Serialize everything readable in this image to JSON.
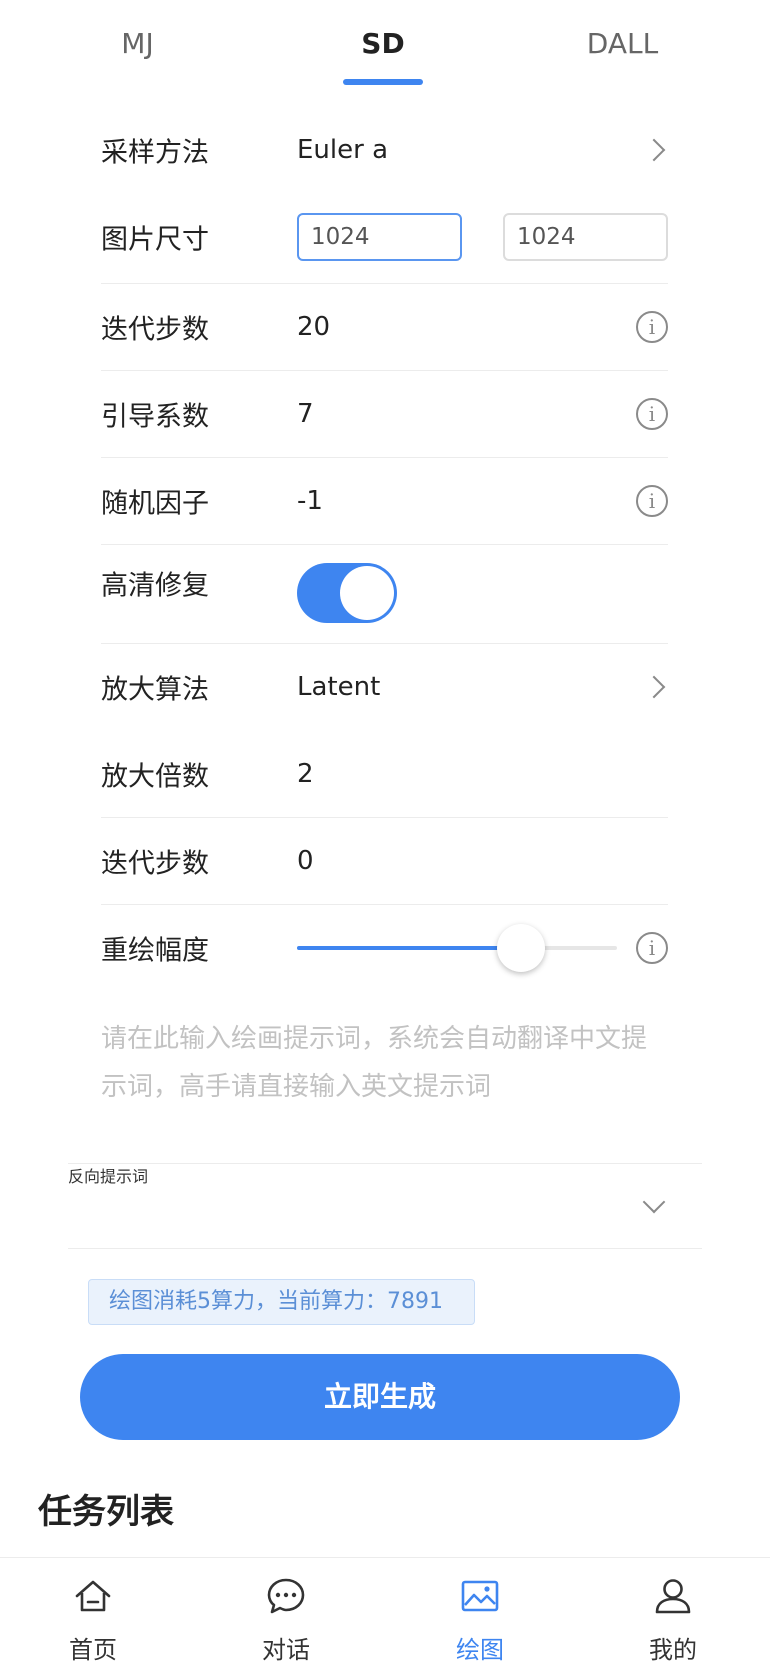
{
  "tabs": [
    {
      "label": "MJ",
      "active": false
    },
    {
      "label": "SD",
      "active": true
    },
    {
      "label": "DALL",
      "active": false
    }
  ],
  "form": {
    "sampler": {
      "label": "采样方法",
      "value": "Euler a"
    },
    "image_size": {
      "label": "图片尺寸",
      "width_value": "1024",
      "height_value": "1024"
    },
    "steps": {
      "label": "迭代步数",
      "value": "20"
    },
    "cfg_scale": {
      "label": "引导系数",
      "value": "7"
    },
    "seed": {
      "label": "随机因子",
      "value": "-1"
    },
    "hires_fix": {
      "label": "高清修复",
      "enabled": true
    },
    "upscaler": {
      "label": "放大算法",
      "value": "Latent"
    },
    "upscale_factor": {
      "label": "放大倍数",
      "value": "2"
    },
    "hires_steps": {
      "label": "迭代步数",
      "value": "0"
    },
    "denoising_strength": {
      "label": "重绘幅度",
      "level_fraction": 0.7
    }
  },
  "prompt": {
    "placeholder": "请在此输入绘画提示词，系统会自动翻译中文提示词，高手请直接输入英文提示词"
  },
  "negative_prompt": {
    "label": "反向提示词"
  },
  "power_info": "绘图消耗5算力，当前算力：7891",
  "generate_button": "立即生成",
  "task_list_title": "任务列表",
  "bottom_nav": [
    {
      "label": "首页",
      "icon": "home-icon",
      "active": false
    },
    {
      "label": "对话",
      "icon": "chat-icon",
      "active": false
    },
    {
      "label": "绘图",
      "icon": "image-icon",
      "active": true
    },
    {
      "label": "我的",
      "icon": "user-icon",
      "active": false
    }
  ],
  "colors": {
    "accent": "#3e85f0",
    "text": "#222222",
    "placeholder": "#c2c2c2",
    "badge_bg": "#eaf2fc"
  }
}
